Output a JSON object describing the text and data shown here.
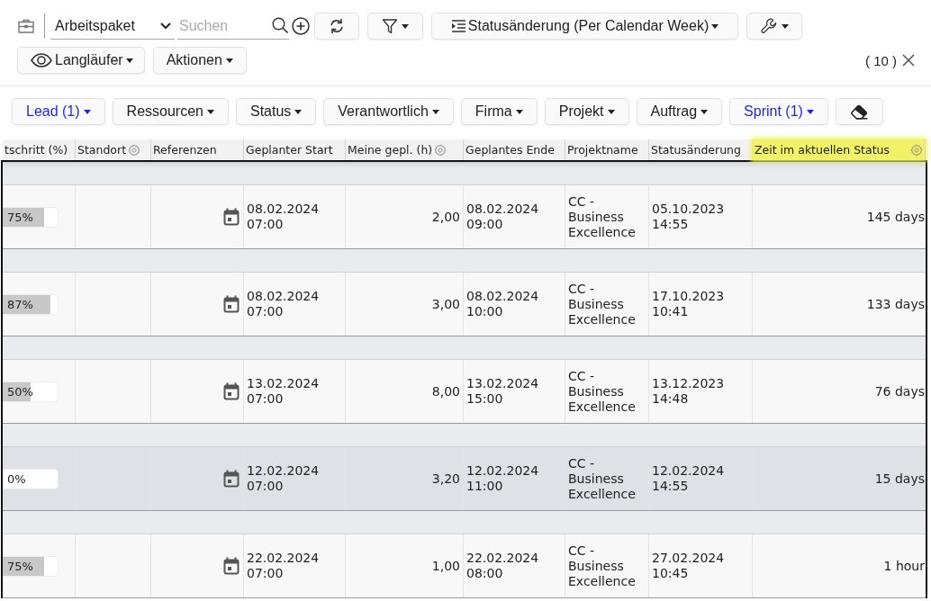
{
  "toolbar": {
    "object_select": {
      "value": "Arbeitspaket"
    },
    "search": {
      "placeholder": "Suchen"
    },
    "view_menu": {
      "label": "Statusänderung (Per Calendar Week)"
    }
  },
  "action_bar": {
    "buttons": [
      {
        "kind": "view",
        "label": "Langläufer"
      },
      {
        "kind": "menu",
        "label": "Aktionen"
      }
    ],
    "count": "( 10 )"
  },
  "filters": [
    {
      "label": "Lead (1)",
      "active": true
    },
    {
      "label": "Ressourcen",
      "active": false
    },
    {
      "label": "Status",
      "active": false
    },
    {
      "label": "Verantwortlich",
      "active": false
    },
    {
      "label": "Firma",
      "active": false
    },
    {
      "label": "Projekt",
      "active": false
    },
    {
      "label": "Auftrag",
      "active": false
    },
    {
      "label": "Sprint (1)",
      "active": true
    }
  ],
  "table": {
    "columns": [
      {
        "label": "tschritt (%)",
        "settings": false,
        "highlighted": false
      },
      {
        "label": "Standort",
        "settings": true,
        "highlighted": false
      },
      {
        "label": "Referenzen",
        "settings": false,
        "highlighted": false
      },
      {
        "label": "Geplanter Start",
        "settings": false,
        "highlighted": false
      },
      {
        "label": "Meine gepl. (h)",
        "settings": true,
        "highlighted": false
      },
      {
        "label": "Geplantes Ende",
        "settings": false,
        "highlighted": false
      },
      {
        "label": "Projektname",
        "settings": false,
        "highlighted": false
      },
      {
        "label": "Statusänderung",
        "settings": false,
        "highlighted": false
      },
      {
        "label": "Zeit im aktuellen Status",
        "settings": true,
        "highlighted": true
      }
    ],
    "rows": [
      {
        "selected": false,
        "progress": {
          "label": "75%",
          "level": 0.75
        },
        "planned_start": "08.02.2024 07:00",
        "my_planned_hours": "2,00",
        "planned_end": "08.02.2024 09:00",
        "project": "CC - Business Excellence",
        "status_change": "05.10.2023 14:55",
        "time_in_status": "145 days"
      },
      {
        "selected": false,
        "progress": {
          "label": "87%",
          "level": 0.87
        },
        "planned_start": "08.02.2024 07:00",
        "my_planned_hours": "3,00",
        "planned_end": "08.02.2024 10:00",
        "project": "CC - Business Excellence",
        "status_change": "17.10.2023 10:41",
        "time_in_status": "133 days"
      },
      {
        "selected": false,
        "progress": {
          "label": "50%",
          "level": 0.5
        },
        "planned_start": "13.02.2024 07:00",
        "my_planned_hours": "8,00",
        "planned_end": "13.02.2024 15:00",
        "project": "CC - Business Excellence",
        "status_change": "13.12.2023 14:48",
        "time_in_status": "76 days"
      },
      {
        "selected": true,
        "progress": {
          "label": "0%",
          "level": 0
        },
        "planned_start": "12.02.2024 07:00",
        "my_planned_hours": "3,20",
        "planned_end": "12.02.2024 11:00",
        "project": "CC - Business Excellence",
        "status_change": "12.02.2024 14:55",
        "time_in_status": "15 days"
      },
      {
        "selected": false,
        "progress": {
          "label": "75%",
          "level": 0.75
        },
        "planned_start": "22.02.2024 07:00",
        "my_planned_hours": "1,00",
        "planned_end": "22.02.2024 08:00",
        "project": "CC - Business Excellence",
        "status_change": "27.02.2024 10:45",
        "time_in_status": "1 hour"
      }
    ]
  }
}
